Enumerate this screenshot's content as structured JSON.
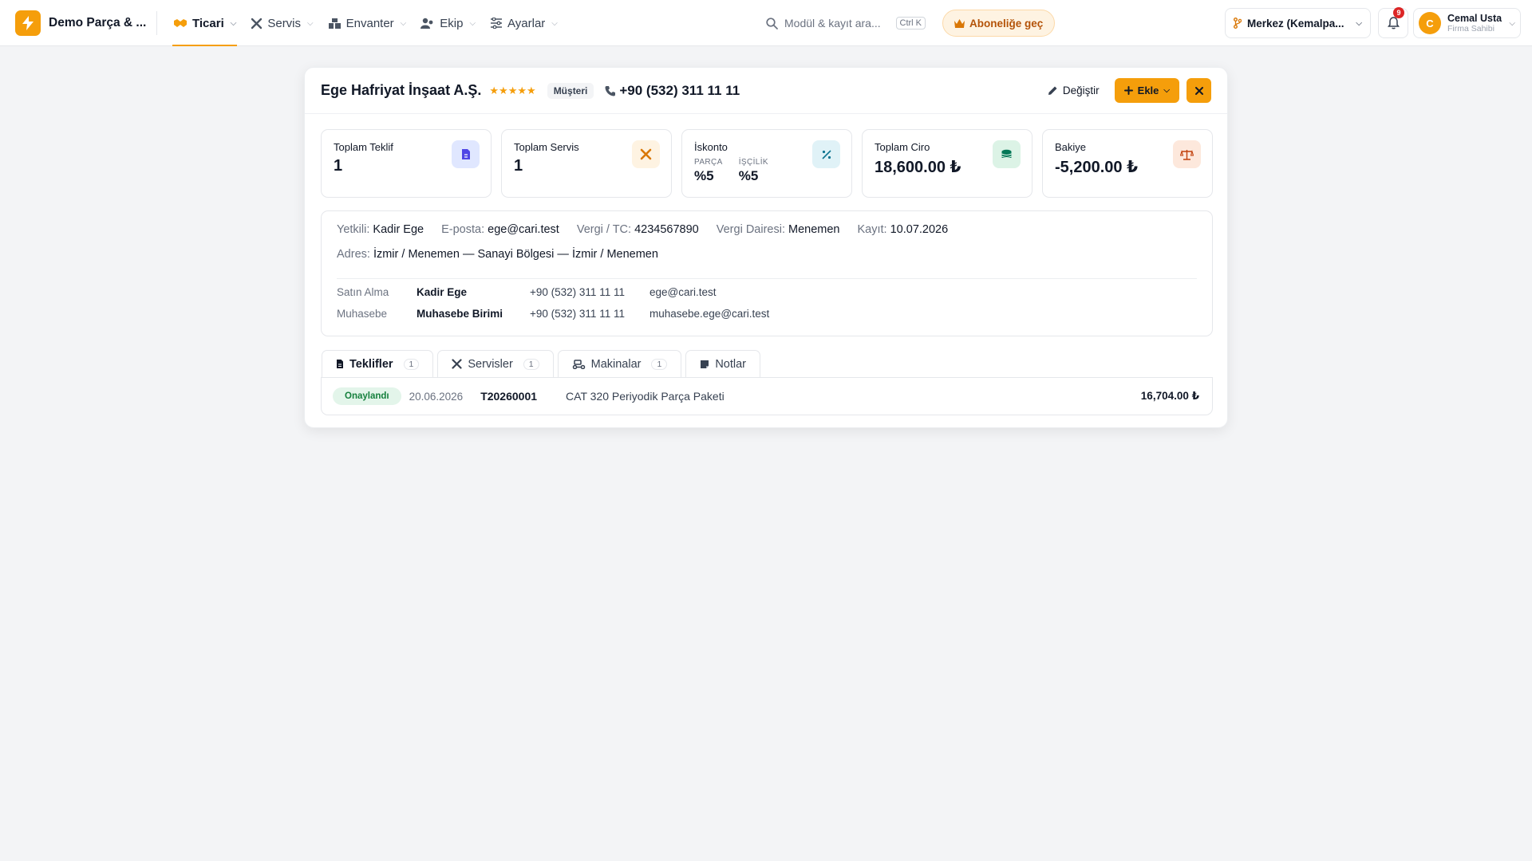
{
  "app": {
    "brand": "Demo Parça & ...",
    "accent": "#f59e0b"
  },
  "nav": {
    "items": [
      {
        "label": "Ticari",
        "icon": "handshake-icon",
        "active": true
      },
      {
        "label": "Servis",
        "icon": "tools-icon"
      },
      {
        "label": "Envanter",
        "icon": "warehouse-icon"
      },
      {
        "label": "Ekip",
        "icon": "users-icon"
      },
      {
        "label": "Ayarlar",
        "icon": "sliders-icon"
      }
    ]
  },
  "search": {
    "placeholder": "Modül & kayıt ara...",
    "shortcut": "Ctrl K"
  },
  "upgrade": {
    "label": "Aboneliğe geç"
  },
  "branch": {
    "label": "Merkez (Kemalpa..."
  },
  "notifications": {
    "count": "9"
  },
  "user": {
    "initial": "C",
    "name": "Cemal Usta",
    "role": "Firma Sahibi"
  },
  "customer": {
    "title": "Ege Hafriyat İnşaat A.Ş.",
    "rating": 5,
    "type_badge": "Müşteri",
    "phone": "+90 (532) 311 11 11",
    "edit_label": "Değiştir",
    "add_label": "Ekle"
  },
  "stats": {
    "offers": {
      "label": "Toplam Teklif",
      "value": "1"
    },
    "services": {
      "label": "Toplam Servis",
      "value": "1"
    },
    "discount": {
      "label": "İskonto",
      "parts_label": "PARÇA",
      "parts_value": "%5",
      "labor_label": "İŞÇİLİK",
      "labor_value": "%5"
    },
    "revenue": {
      "label": "Toplam Ciro",
      "value": "18,600.00 ₺"
    },
    "balance": {
      "label": "Bakiye",
      "value": "-5,200.00 ₺"
    }
  },
  "info": {
    "contact_person": {
      "label": "Yetkili:",
      "value": "Kadir Ege"
    },
    "email": {
      "label": "E-posta:",
      "value": "ege@cari.test"
    },
    "tax_id": {
      "label": "Vergi / TC:",
      "value": "4234567890"
    },
    "tax_office": {
      "label": "Vergi Dairesi:",
      "value": "Menemen"
    },
    "registered": {
      "label": "Kayıt:",
      "value": "10.07.2026"
    },
    "address": {
      "label": "Adres:",
      "value": "İzmir / Menemen — Sanayi Bölgesi — İzmir / Menemen"
    },
    "contacts": [
      {
        "role": "Satın Alma",
        "name": "Kadir Ege",
        "phone": "+90 (532) 311 11 11",
        "email": "ege@cari.test"
      },
      {
        "role": "Muhasebe",
        "name": "Muhasebe Birimi",
        "phone": "+90 (532) 311 11 11",
        "email": "muhasebe.ege@cari.test"
      }
    ]
  },
  "tabs": [
    {
      "label": "Teklifler",
      "count": "1",
      "active": true
    },
    {
      "label": "Servisler",
      "count": "1"
    },
    {
      "label": "Makinalar",
      "count": "1"
    },
    {
      "label": "Notlar"
    }
  ],
  "offers": [
    {
      "status": "Onaylandı",
      "date": "20.06.2026",
      "number": "T20260001",
      "description": "CAT 320 Periyodik Parça Paketi",
      "amount": "16,704.00 ₺"
    }
  ]
}
